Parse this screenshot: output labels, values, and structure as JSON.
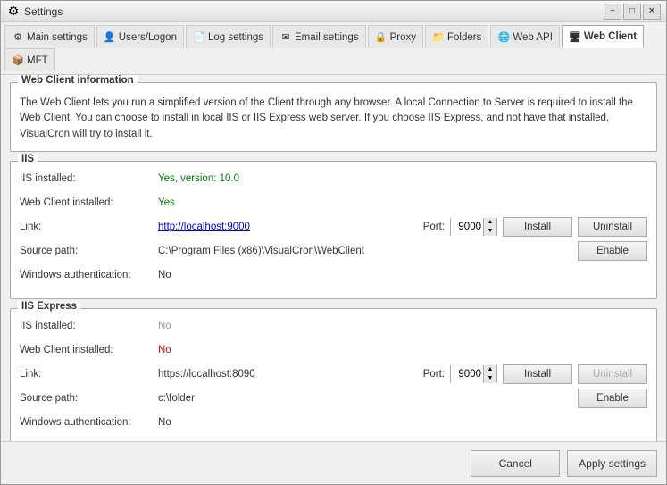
{
  "window": {
    "title": "Settings",
    "icon": "⚙"
  },
  "titlebar": {
    "minimize": "−",
    "maximize": "□",
    "close": "✕"
  },
  "tabs": [
    {
      "id": "main-settings",
      "label": "Main settings",
      "icon": "⚙",
      "active": false
    },
    {
      "id": "users-logon",
      "label": "Users/Logon",
      "icon": "👤",
      "active": false
    },
    {
      "id": "log-settings",
      "label": "Log settings",
      "icon": "📄",
      "active": false
    },
    {
      "id": "email-settings",
      "label": "Email settings",
      "icon": "✉",
      "active": false
    },
    {
      "id": "proxy",
      "label": "Proxy",
      "icon": "🔒",
      "active": false
    },
    {
      "id": "folders",
      "label": "Folders",
      "icon": "📁",
      "active": false
    },
    {
      "id": "web-api",
      "label": "Web API",
      "icon": "🌐",
      "active": false
    },
    {
      "id": "web-client",
      "label": "Web Client",
      "icon": "🌐",
      "active": true
    },
    {
      "id": "mft",
      "label": "MFT",
      "icon": "📦",
      "active": false
    }
  ],
  "sections": {
    "web_client_info": {
      "title": "Web Client information",
      "description": "The Web Client lets you run a simplified version of the Client through any browser. A local Connection to Server is required to install the Web Client. You can choose to install in local IIS or IIS Express web server. If you choose IIS Express, and not have that installed, VisualCron will try to install it."
    },
    "iis": {
      "title": "IIS",
      "fields": [
        {
          "label": "IIS installed:",
          "value": "Yes, version: 10.0",
          "style": "green"
        },
        {
          "label": "Web Client installed:",
          "value": "Yes",
          "style": "green"
        },
        {
          "label": "Link:",
          "value": "http://localhost:9000",
          "style": "link"
        },
        {
          "label": "Source path:",
          "value": "C:\\Program Files (x86)\\VisualCron\\WebClient",
          "style": "normal"
        }
      ],
      "port_label": "Port:",
      "port_value": "9000",
      "install_label": "Install",
      "uninstall_label": "Uninstall",
      "enable_label": "Enable",
      "windows_auth_label": "Windows authentication:",
      "windows_auth_value": "No"
    },
    "iis_express": {
      "title": "IIS Express",
      "fields": [
        {
          "label": "IIS installed:",
          "value": "No",
          "style": "gray"
        },
        {
          "label": "Web Client installed:",
          "value": "No",
          "style": "red"
        },
        {
          "label": "Link:",
          "value": "https://localhost:8090",
          "style": "normal"
        },
        {
          "label": "Source path:",
          "value": "c:\\folder",
          "style": "normal"
        }
      ],
      "port_label": "Port:",
      "port_value": "9000",
      "install_label": "Install",
      "uninstall_label": "Uninstall",
      "enable_label": "Enable",
      "windows_auth_label": "Windows authentication:",
      "windows_auth_value": "No"
    }
  },
  "footer": {
    "cancel_label": "Cancel",
    "apply_label": "Apply settings"
  }
}
